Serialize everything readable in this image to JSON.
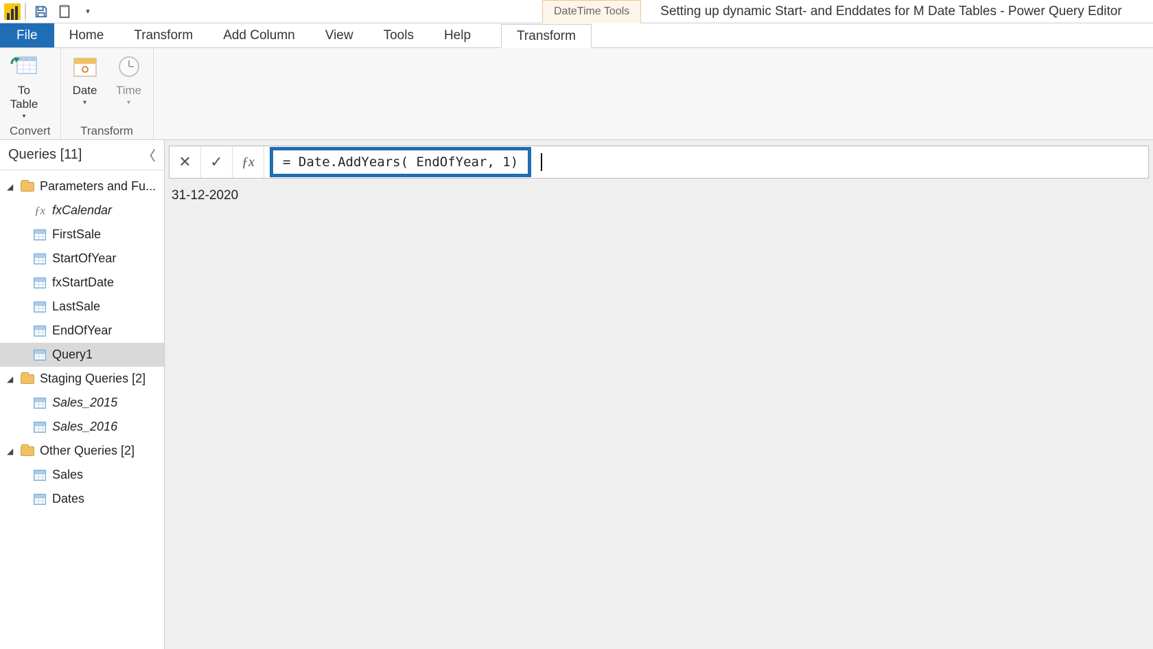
{
  "titlebar": {
    "tool_tab": "DateTime Tools",
    "doc_title": "Setting up dynamic Start- and Enddates for M Date Tables - Power Query Editor"
  },
  "tabs": {
    "file": "File",
    "items": [
      "Home",
      "Transform",
      "Add Column",
      "View",
      "Tools",
      "Help"
    ],
    "context": "Transform"
  },
  "ribbon": {
    "convert": {
      "to_table": "To\nTable",
      "group": "Convert"
    },
    "transform": {
      "date": "Date",
      "time": "Time",
      "group": "Transform"
    }
  },
  "queries": {
    "header": "Queries [11]",
    "groups": [
      {
        "name": "Parameters and Fu...",
        "items": [
          {
            "label": "fxCalendar",
            "type": "fx",
            "italic": true
          },
          {
            "label": "FirstSale",
            "type": "table"
          },
          {
            "label": "StartOfYear",
            "type": "table"
          },
          {
            "label": "fxStartDate",
            "type": "table"
          },
          {
            "label": "LastSale",
            "type": "table"
          },
          {
            "label": "EndOfYear",
            "type": "table"
          },
          {
            "label": "Query1",
            "type": "table",
            "selected": true
          }
        ]
      },
      {
        "name": "Staging Queries [2]",
        "items": [
          {
            "label": "Sales_2015",
            "type": "table",
            "italic": true
          },
          {
            "label": "Sales_2016",
            "type": "table",
            "italic": true
          }
        ]
      },
      {
        "name": "Other Queries [2]",
        "items": [
          {
            "label": "Sales",
            "type": "table"
          },
          {
            "label": "Dates",
            "type": "table"
          }
        ]
      }
    ]
  },
  "formula": "= Date.AddYears( EndOfYear, 1)",
  "result": "31-12-2020"
}
